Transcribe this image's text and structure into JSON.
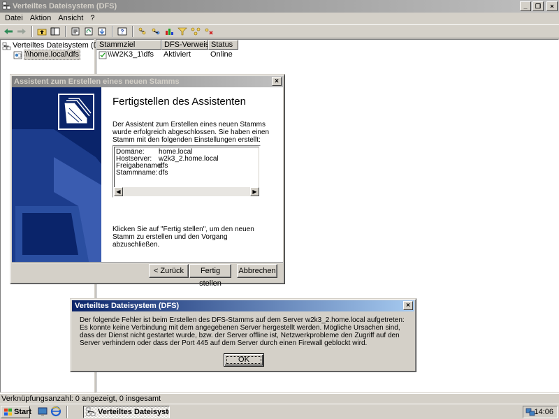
{
  "main_window": {
    "title": "Verteiltes Dateisystem (DFS)",
    "menu": [
      "Datei",
      "Aktion",
      "Ansicht",
      "?"
    ],
    "tree": {
      "root": "Verteiltes Dateisystem (DFS)",
      "child": "\\\\home.local\\dfs"
    },
    "list": {
      "columns": [
        "Stammziel",
        "DFS-Verweis",
        "Status"
      ],
      "rows": [
        {
          "stammziel": "\\\\W2K3_1\\dfs",
          "verweis": "Aktiviert",
          "status": "Online"
        }
      ]
    },
    "status_bar": "Verknüpfungsanzahl: 0 angezeigt, 0 insgesamt"
  },
  "wizard": {
    "title": "Assistent zum Erstellen eines neuen Stamms",
    "heading": "Fertigstellen des Assistenten",
    "intro": "Der Assistent zum Erstellen eines neuen Stamms wurde erfolgreich abgeschlossen. Sie haben einen Stamm mit den folgenden Einstellungen erstellt:",
    "summary": [
      {
        "key": "Domäne:",
        "value": "home.local"
      },
      {
        "key": "Hostserver:",
        "value": "w2k3_2.home.local"
      },
      {
        "key": "Freigabename:",
        "value": "dfs"
      },
      {
        "key": "Stammname:",
        "value": "dfs"
      }
    ],
    "footer_text": "Klicken Sie auf \"Fertig stellen\", um den neuen Stamm zu erstellen und den Vorgang abzuschließen.",
    "buttons": {
      "back": "< Zurück",
      "finish": "Fertig stellen",
      "cancel": "Abbrechen"
    }
  },
  "error_dialog": {
    "title": "Verteiltes Dateisystem (DFS)",
    "message_line1": "Der folgende Fehler ist beim Erstellen des DFS-Stamms auf dem Server w2k3_2.home.local aufgetreten:",
    "message_line2": "Es konnte keine Verbindung mit dem angegebenen Server hergestellt werden. Mögliche Ursachen sind, dass der Dienst nicht gestartet wurde, bzw. der Server offline ist, Netzwerkprobleme den Zugriff auf den Server verhindern oder dass der Port 445 auf dem Server durch einen Firewall geblockt wird.",
    "ok_label": "OK"
  },
  "taskbar": {
    "start_label": "Start",
    "task_label": "Verteiltes Dateisyste...",
    "clock": "14:06"
  },
  "colors": {
    "active_title": "#0a246a",
    "inactive_title": "#808080",
    "face": "#d4d0c8"
  }
}
